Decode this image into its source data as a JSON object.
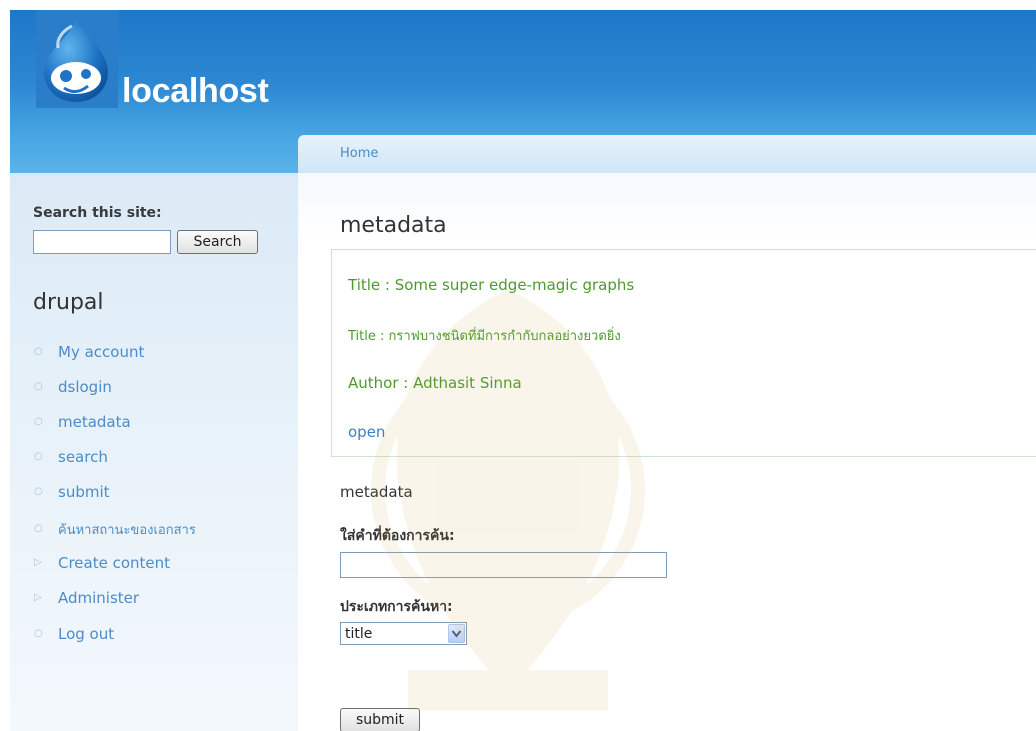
{
  "header": {
    "site_name": "localhost",
    "logo_icon": "drupal-drop-logo-icon"
  },
  "breadcrumb": {
    "items": [
      "Home"
    ]
  },
  "sidebar": {
    "search": {
      "label": "Search this site:",
      "value": "",
      "button_label": "Search"
    },
    "block_title": "drupal",
    "menu": [
      {
        "label": "My account",
        "bullet": "leaf-icon"
      },
      {
        "label": "dslogin",
        "bullet": "leaf-icon"
      },
      {
        "label": "metadata",
        "bullet": "leaf-icon"
      },
      {
        "label": "search",
        "bullet": "leaf-icon"
      },
      {
        "label": "submit",
        "bullet": "leaf-icon"
      },
      {
        "label": "ค้นหาสถานะของเอกสาร",
        "bullet": "leaf-icon"
      },
      {
        "label": "Create content",
        "bullet": "collapsed-icon"
      },
      {
        "label": "Administer",
        "bullet": "collapsed-icon"
      },
      {
        "label": "Log out",
        "bullet": "leaf-icon"
      }
    ]
  },
  "main": {
    "page_title": "metadata",
    "result": {
      "title_en": "Title : Some super edge-magic graphs",
      "title_th": "Title : กราฟบางชนิดที่มีการกำกับกลอย่างยวดยิ่ง",
      "author": "Author : Adthasit Sinna",
      "open_link": "open"
    },
    "form": {
      "heading": "metadata",
      "query_label": "ใส่คำที่ต้องการค้น:",
      "query_value": "",
      "type_label": "ประเภทการค้นหา:",
      "type_selected": "title",
      "submit_label": "submit"
    }
  },
  "colors": {
    "header_blue": "#2d87d2",
    "link_blue": "#4b8cc9",
    "result_green": "#4e9a2f"
  }
}
